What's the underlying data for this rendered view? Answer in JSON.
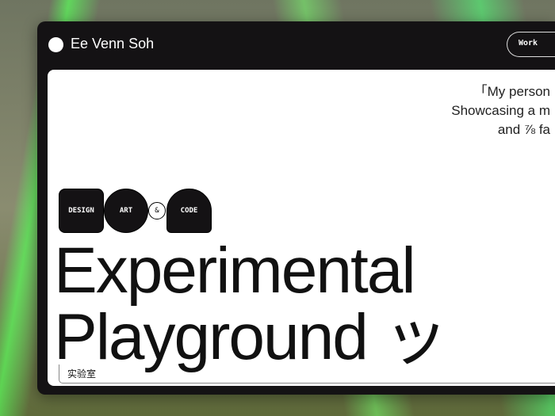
{
  "header": {
    "brand": "Ee Venn Soh",
    "nav_button": "Work"
  },
  "hero": {
    "tagline": [
      "「My person",
      "Showcasing a m",
      "and ⅞ fa"
    ],
    "chips": {
      "design": "DESIGN",
      "art": "ART",
      "amp": "&",
      "code": "CODE"
    },
    "title_line1": "Experimental",
    "title_line2": "Playground ッ",
    "subtitle": "实验室"
  }
}
